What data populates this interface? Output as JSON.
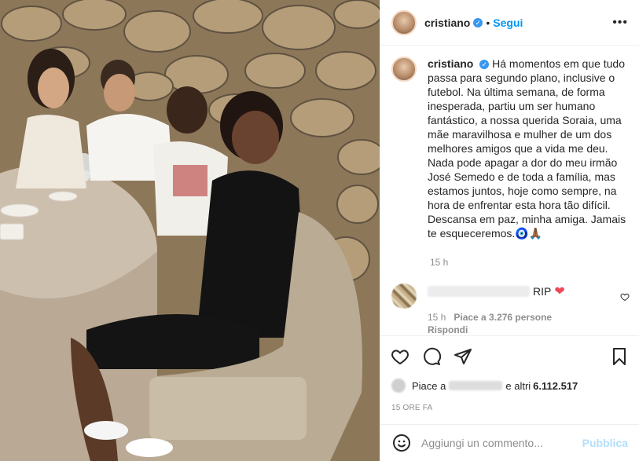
{
  "photo": {
    "alt_icon": "dinner-photo"
  },
  "header": {
    "username": "cristiano",
    "verified_icon": "verified-badge-icon",
    "separator": "•",
    "follow_label": "Segui",
    "more_icon": "more-options-icon"
  },
  "caption": {
    "username": "cristiano",
    "text": "Há momentos em que tudo passa para segundo plano, inclusive o futebol. Na última semana, de forma inesperada, partiu um ser humano fantástico, a nossa querida Soraia, uma mãe maravilhosa e mulher de um dos melhores amigos que a vida me deu. Nada pode apagar a dor do meu irmão José Semedo e de toda a família, mas estamos juntos, hoje como sempre, na hora de enfrentar esta hora tão difícil. Descansa em paz, minha amiga. Jamais te esqueceremos.🧿🙏🏾",
    "time": "15 h"
  },
  "comment": {
    "text": "RIP",
    "heart": "❤",
    "time": "15 h",
    "likes": "Piace a 3.276 persone",
    "reply_label": "Rispondi"
  },
  "actions": [
    "like-icon",
    "comment-icon",
    "share-icon",
    "bookmark-icon"
  ],
  "likes": {
    "prefix": "Piace a",
    "suffix": "e altri",
    "count": "6.112.517"
  },
  "date": "15 ORE FA",
  "add_comment": {
    "placeholder": "Aggiungi un commento...",
    "publish_label": "Pubblica"
  },
  "colors": {
    "accent": "#0095f6",
    "verified": "#3897f0",
    "heart": "#ed4956",
    "publish_disabled": "#b2dffc",
    "muted": "#8e8e8e"
  }
}
